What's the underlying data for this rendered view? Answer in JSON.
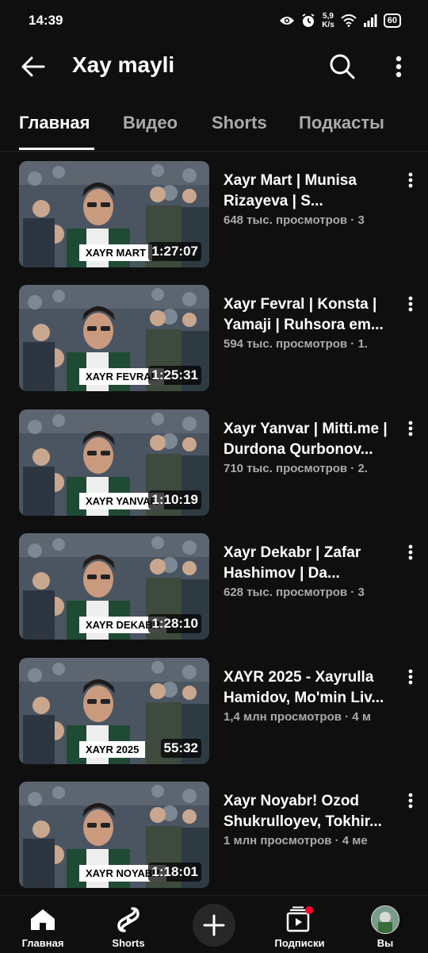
{
  "status": {
    "time": "14:39",
    "speed_value": "5,9",
    "speed_unit": "K/s",
    "battery": "60"
  },
  "header": {
    "title": "Xay mayli",
    "back_icon": "arrow-left-icon",
    "search_icon": "search-icon",
    "more_icon": "more-vert-icon"
  },
  "tabs": [
    {
      "label": "Главная",
      "active": true
    },
    {
      "label": "Видео",
      "active": false
    },
    {
      "label": "Shorts",
      "active": false
    },
    {
      "label": "Подкасты",
      "active": false
    }
  ],
  "videos": [
    {
      "title": "Xayr Mart | Munisa Rizayeva | S...",
      "views": "648 тыс. просмотров · 3",
      "duration": "1:27:07",
      "thumb_label": "XAYR MART"
    },
    {
      "title": "Xayr Fevral | Konsta | Yamaji | Ruhsora em...",
      "views": "594 тыс. просмотров · 1.",
      "duration": "1:25:31",
      "thumb_label": "XAYR FEVRAL"
    },
    {
      "title": "Xayr Yanvar | Mitti.me | Durdona Qurbonov...",
      "views": "710 тыс. просмотров · 2.",
      "duration": "1:10:19",
      "thumb_label": "XAYR YANVAR"
    },
    {
      "title": "Xayr Dekabr | Zafar Hashimov | Da...",
      "views": "628 тыс. просмотров · 3",
      "duration": "1:28:10",
      "thumb_label": "XAYR DEKABR"
    },
    {
      "title": "XAYR 2025 - Xayrulla Hamidov, Mo'min Liv...",
      "views": "1,4 млн просмотров · 4 м",
      "duration": "55:32",
      "thumb_label": "XAYR 2025"
    },
    {
      "title": "Xayr Noyabr! Ozod Shukrulloyev, Tokhir...",
      "views": "1 млн просмотров · 4 ме",
      "duration": "1:18:01",
      "thumb_label": "XAYR NOYABR"
    }
  ],
  "bottom_nav": {
    "home": "Главная",
    "shorts": "Shorts",
    "create_icon": "plus-icon",
    "subscriptions": "Подписки",
    "you": "Вы"
  },
  "colors": {
    "background": "#0f0f0f",
    "text": "#f1f1f1",
    "secondary_text": "#aaaaaa",
    "notification_dot": "#ff0033"
  }
}
